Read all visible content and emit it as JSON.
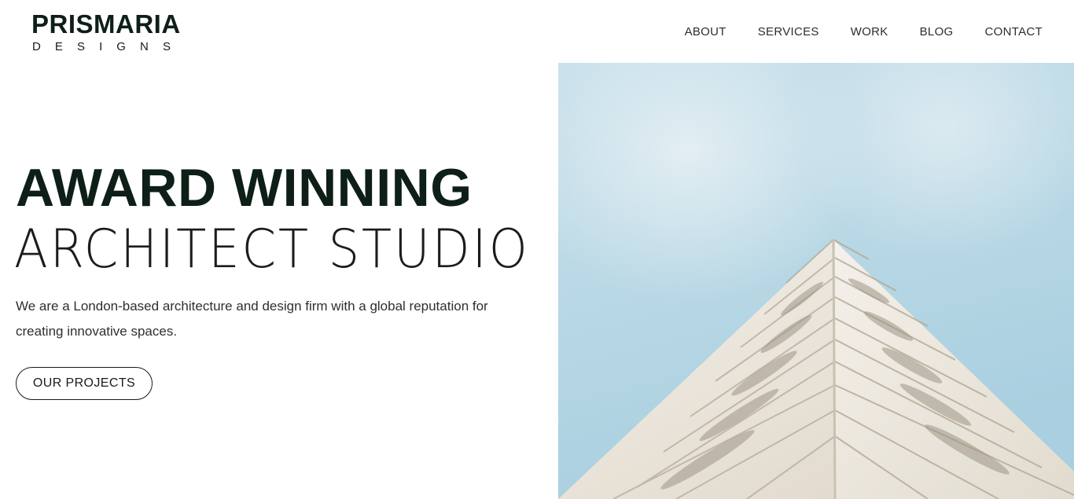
{
  "brand": {
    "name": "PRISMARIA",
    "tagline_letters": [
      "D",
      "E",
      "S",
      "I",
      "G",
      "N",
      "S"
    ]
  },
  "nav": {
    "items": [
      {
        "label": "ABOUT"
      },
      {
        "label": "SERVICES"
      },
      {
        "label": "WORK"
      },
      {
        "label": "BLOG"
      },
      {
        "label": "CONTACT"
      }
    ]
  },
  "hero": {
    "headline_bold": "AWARD WINNING",
    "headline_light": "ARCHITECT STUDIO",
    "description": "We are a London-based architecture and design firm with a global reputation for creating innovative spaces.",
    "cta_label": "OUR PROJECTS"
  },
  "colors": {
    "heading": "#0d1f16",
    "text": "#2f2f2f",
    "sky": "#bcdbe6",
    "building": "#ece7de"
  },
  "icons": {
    "hero_image": "building-photo"
  }
}
